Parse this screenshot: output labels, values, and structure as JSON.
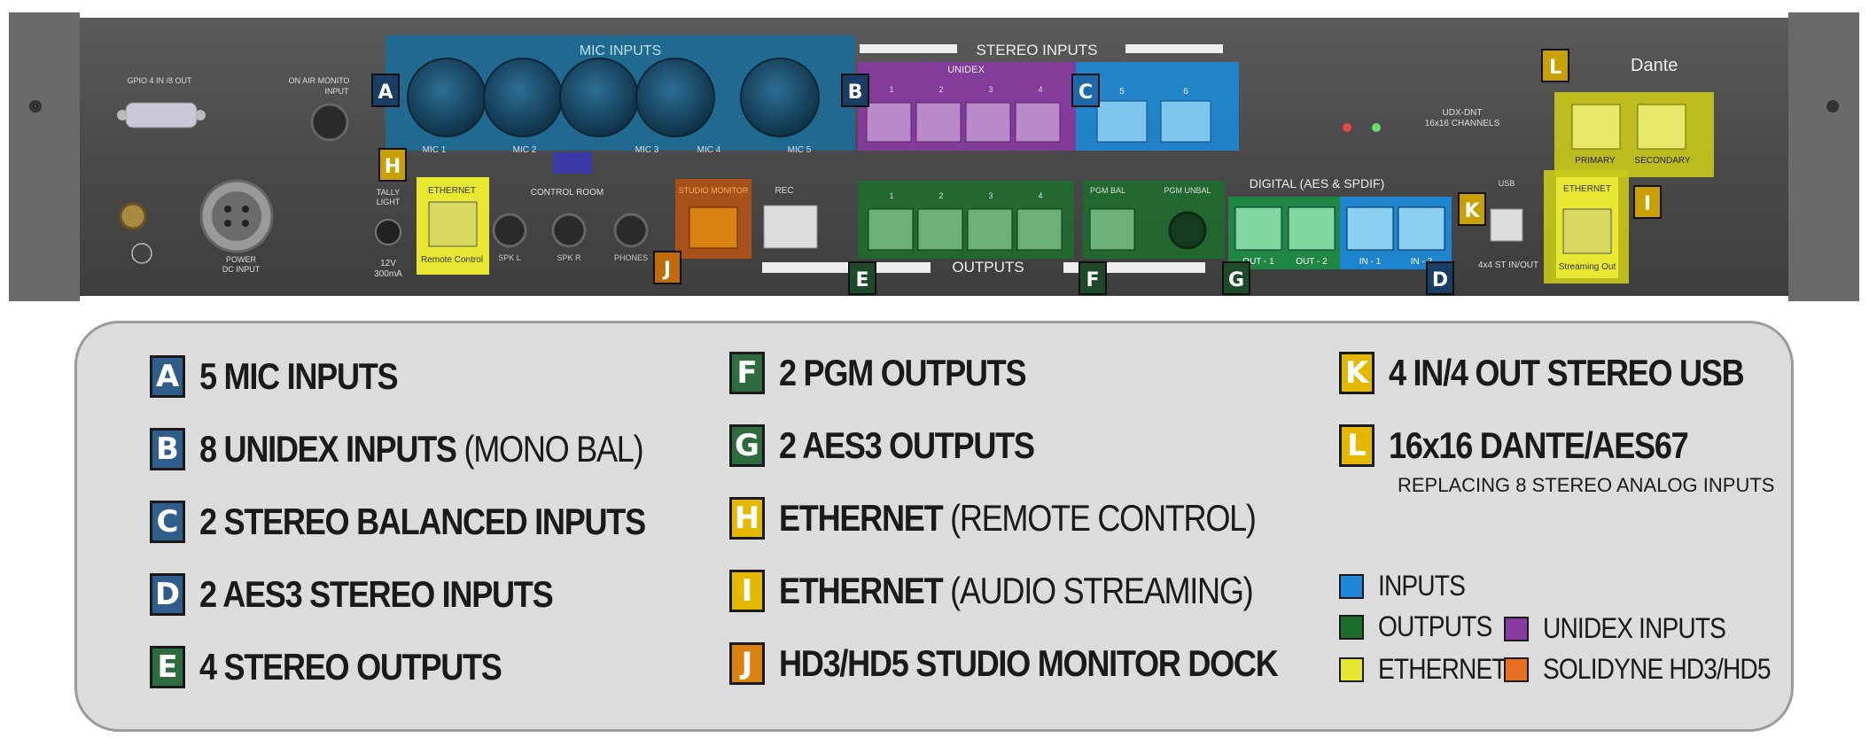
{
  "panel": {
    "labels": {
      "gpio": "GPIO 4 IN /8 OUT",
      "on_air": "ON AIR MONITO",
      "on_air_2": "INPUT",
      "mic_inputs": "MIC INPUTS",
      "stereo_inputs": "STEREO INPUTS",
      "unidex": "UNIDEX",
      "mic1": "MIC 1",
      "mic2": "MIC 2",
      "mic3": "MIC 3",
      "mic4": "MIC 4",
      "mic5": "MIC 5",
      "tally": "TALLY",
      "tally2": "LIGHT",
      "v12": "12V",
      "ma": "300mA",
      "ethernet": "ETHERNET",
      "remote_control": "Remote Control",
      "control_room": "CONTROL ROOM",
      "spk_l": "SPK L",
      "spk_r": "SPK R",
      "phones": "PHONES",
      "studio_monitor": "STUDIO MONITOR",
      "rec": "REC",
      "outputs": "OUTPUTS",
      "pgm_bal": "PGM BAL",
      "pgm_unbal": "PGM UNBAL",
      "digital": "DIGITAL (AES & SPDIF)",
      "out1": "OUT - 1",
      "out2": "OUT - 2",
      "in1": "IN - 1",
      "in2": "IN - 2",
      "usb": "USB",
      "usb_sub": "4x4 ST IN/OUT",
      "udx": "UDX-DNT",
      "udx2": "16x16 CHANNELS",
      "primary": "PRIMARY",
      "secondary": "SECONDARY",
      "streaming_out": "Streaming Out",
      "dante": "Dante",
      "power": "POWER",
      "power2": "DC INPUT",
      "n1": "1",
      "n2": "2",
      "n3": "3",
      "n4": "4",
      "n5": "5",
      "n6": "6"
    },
    "badges": {
      "a": "A",
      "b": "B",
      "c": "C",
      "d": "D",
      "e": "E",
      "f": "F",
      "g": "G",
      "h": "H",
      "i": "I",
      "j": "J",
      "k": "K",
      "l": "L"
    }
  },
  "legend": {
    "items": [
      {
        "letter": "A",
        "bold": "5 MIC INPUTS",
        "rest": "",
        "color": "#2f5d8c"
      },
      {
        "letter": "B",
        "bold": "8 UNIDEX INPUTS",
        "rest": " (MONO BAL)",
        "color": "#2f5d8c"
      },
      {
        "letter": "C",
        "bold": "2 STEREO BALANCED INPUTS",
        "rest": "",
        "color": "#2f5d8c"
      },
      {
        "letter": "D",
        "bold": "2 AES3 STEREO INPUTS",
        "rest": "",
        "color": "#2f5d8c"
      },
      {
        "letter": "E",
        "bold": "4 STEREO OUTPUTS",
        "rest": "",
        "color": "#2e6b3e"
      },
      {
        "letter": "F",
        "bold": "2 PGM OUTPUTS",
        "rest": "",
        "color": "#2e6b3e"
      },
      {
        "letter": "G",
        "bold": "2 AES3 OUTPUTS",
        "rest": "",
        "color": "#2e6b3e"
      },
      {
        "letter": "H",
        "bold": "ETHERNET",
        "rest": " (REMOTE CONTROL)",
        "color": "#e5b800"
      },
      {
        "letter": "I",
        "bold": "ETHERNET",
        "rest": " (AUDIO STREAMING)",
        "color": "#e5b800"
      },
      {
        "letter": "J",
        "bold": "HD3/HD5 STUDIO MONITOR DOCK",
        "rest": "",
        "color": "#d9820f"
      },
      {
        "letter": "K",
        "bold": "4 IN/4 OUT STEREO USB",
        "rest": "",
        "color": "#e5b800"
      },
      {
        "letter": "L",
        "bold": "16x16 DANTE/AES67",
        "rest": "",
        "color": "#e5b800"
      }
    ],
    "l_subtitle": "REPLACING 8 STEREO ANALOG INPUTS",
    "color_key": [
      {
        "label": "INPUTS",
        "color": "#1e88d6"
      },
      {
        "label": "OUTPUTS",
        "color": "#1e6b2e"
      },
      {
        "label": "ETHERNET",
        "color": "#e8e832"
      },
      {
        "label": "UNIDEX INPUTS",
        "color": "#8a3aa3"
      },
      {
        "label": "SOLIDYNE HD3/HD5",
        "color": "#e87020"
      }
    ]
  }
}
